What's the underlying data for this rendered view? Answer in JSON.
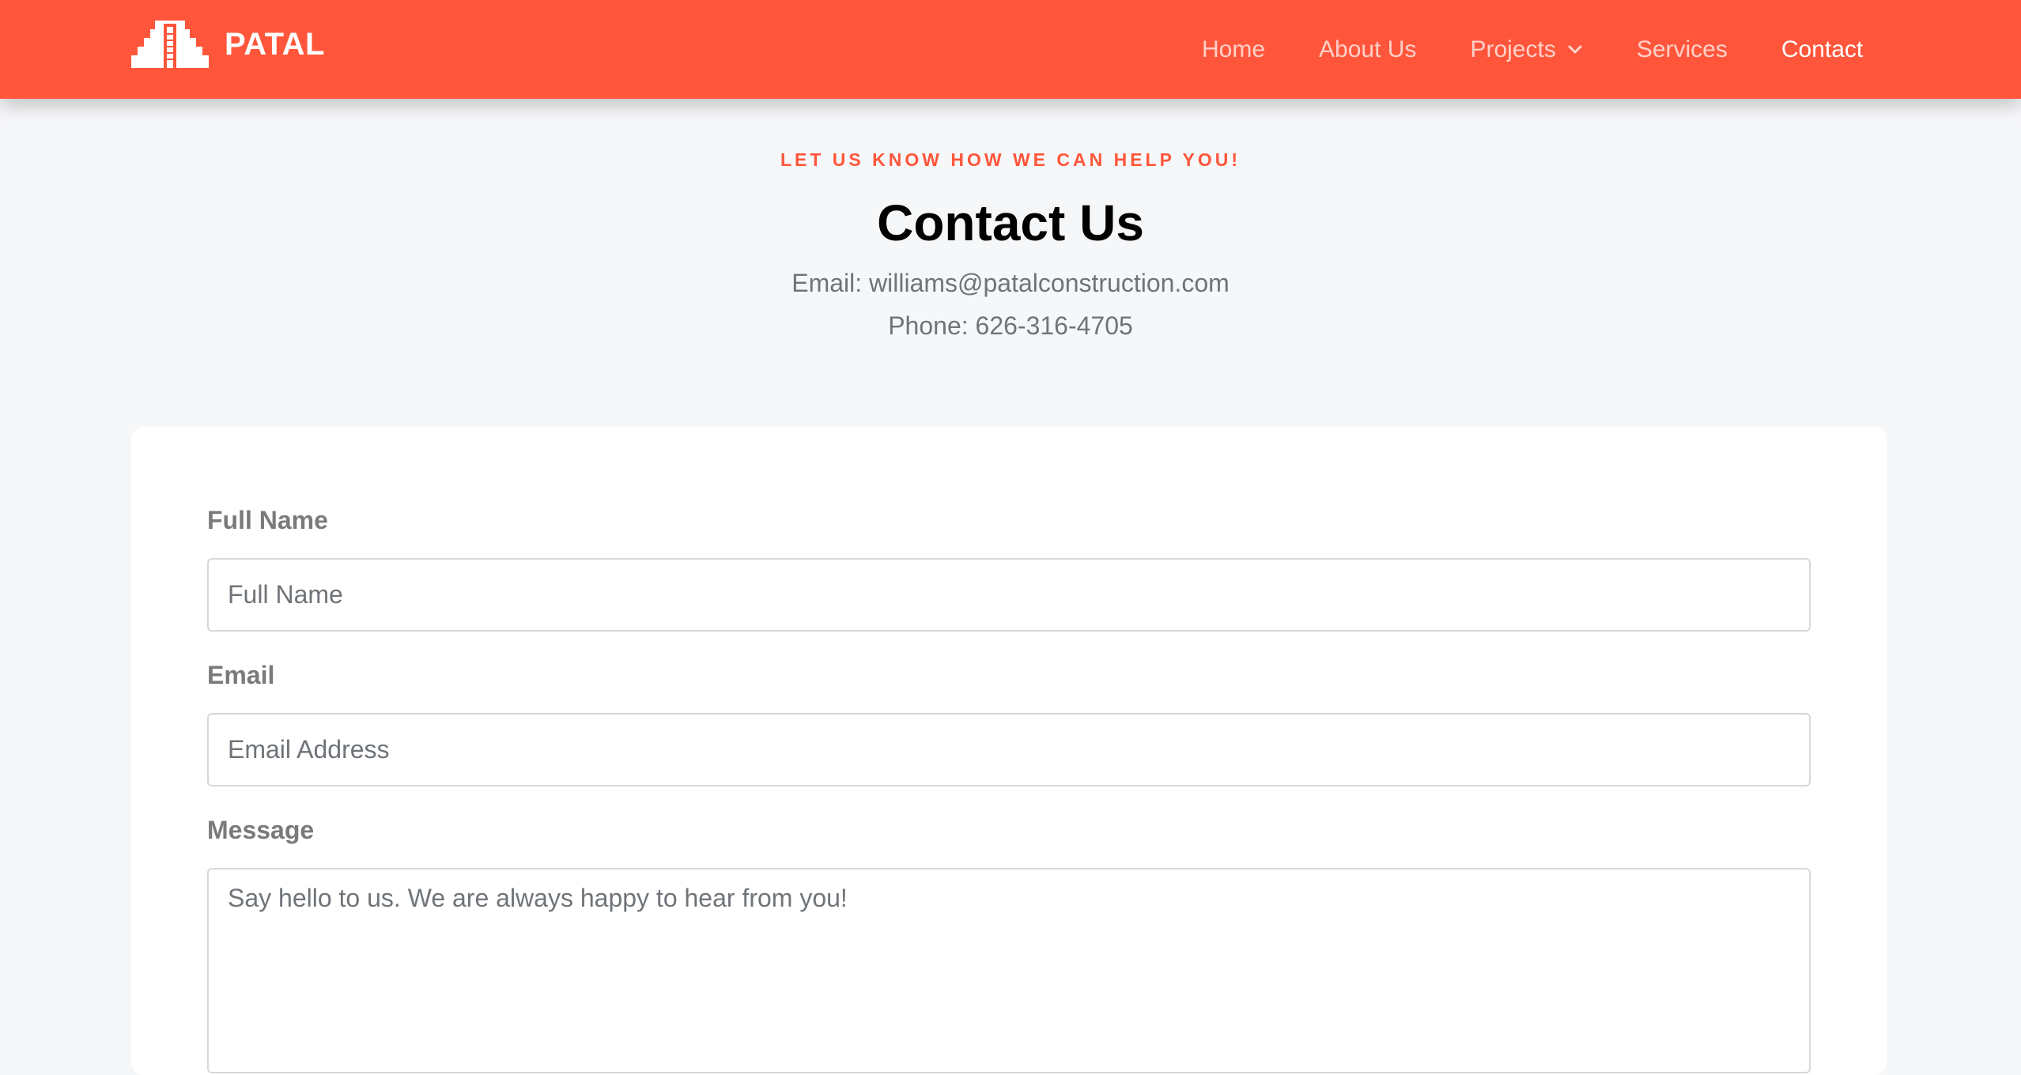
{
  "nav": {
    "brand": "PATAL",
    "logo_icon": "pyramid-logo-icon",
    "items": [
      {
        "label": "Home"
      },
      {
        "label": "About Us"
      },
      {
        "label": "Projects",
        "icon": "chevron-down-icon"
      },
      {
        "label": "Services"
      },
      {
        "label": "Contact",
        "active": true
      }
    ]
  },
  "hero": {
    "eyebrow": "LET US KNOW HOW WE CAN HELP YOU!",
    "title": "Contact Us",
    "email_line": "Email: williams@patalconstruction.com",
    "phone_line": "Phone: 626-316-4705"
  },
  "form": {
    "full_name": {
      "label": "Full Name",
      "placeholder": "Full Name",
      "value": ""
    },
    "email": {
      "label": "Email",
      "placeholder": "Email Address",
      "value": ""
    },
    "message": {
      "label": "Message",
      "placeholder": "Say hello to us. We are always happy to hear from you!",
      "value": ""
    }
  },
  "colors": {
    "brand": "#ff563b",
    "page_bg": "#f6f7f9",
    "card_bg": "#ffffff",
    "label_text": "#7a7a7a",
    "muted_text": "#6f7479"
  }
}
